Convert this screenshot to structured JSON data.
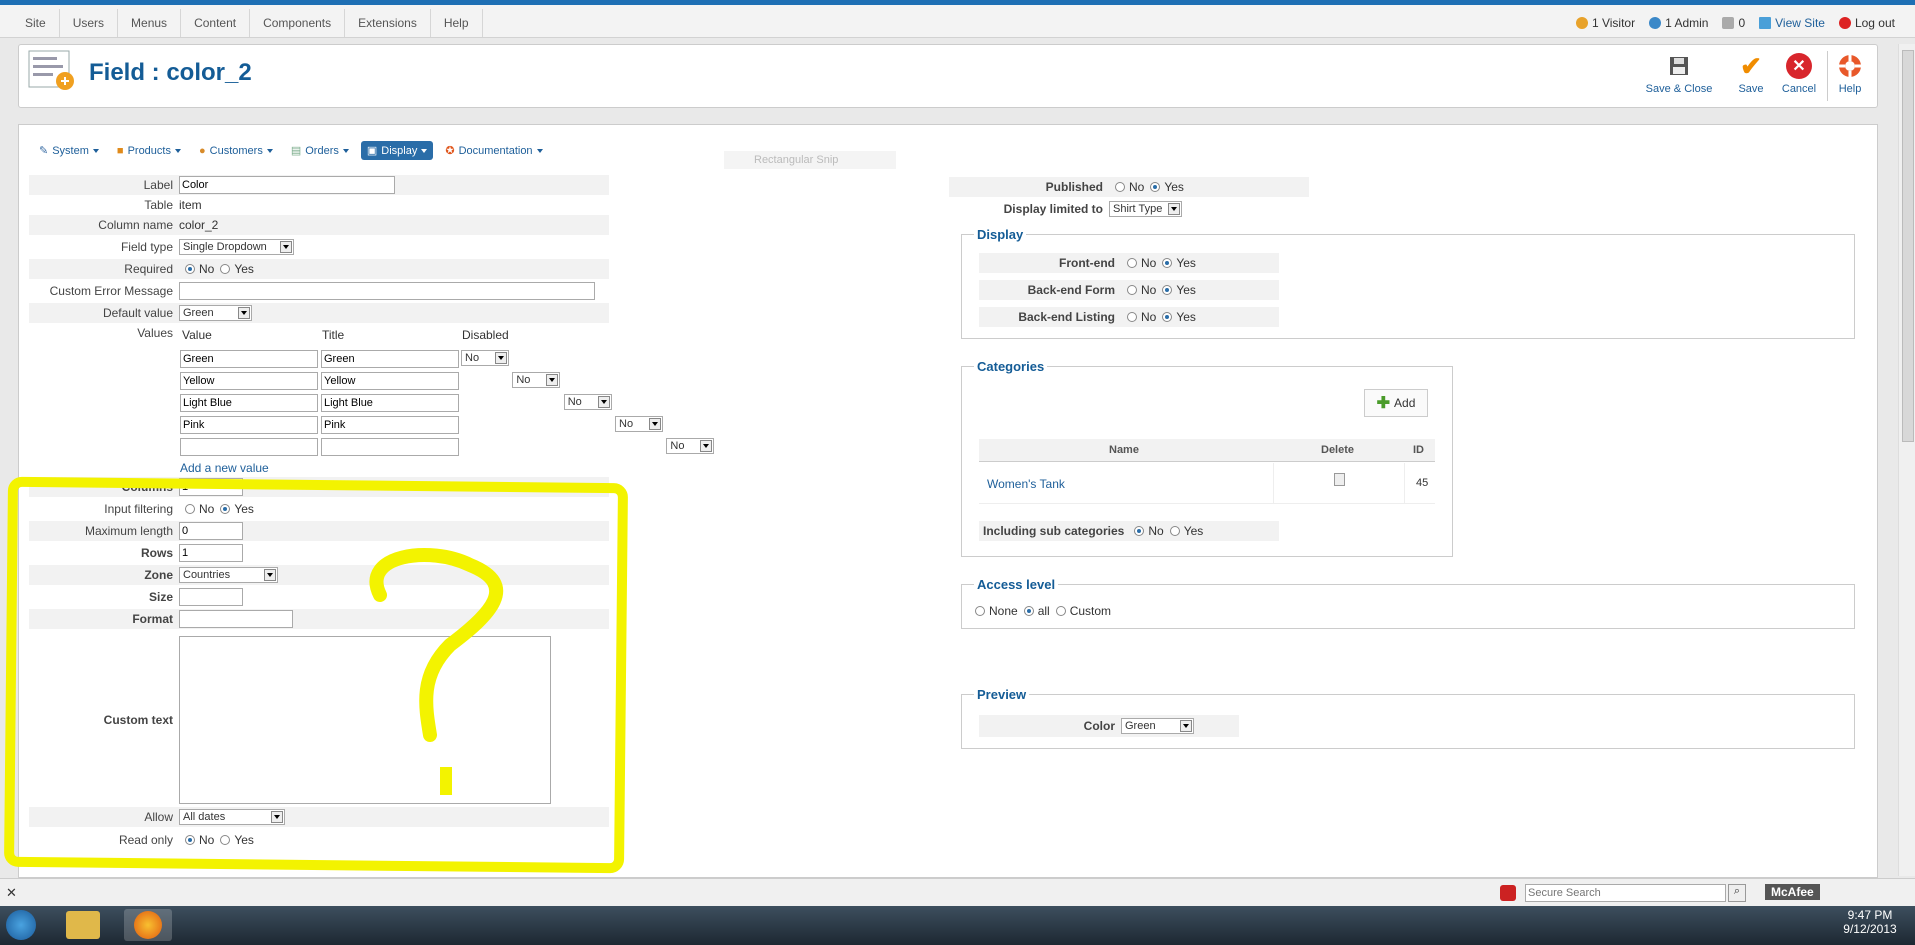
{
  "topbar": {
    "menu": [
      "Site",
      "Users",
      "Menus",
      "Content",
      "Components",
      "Extensions",
      "Help"
    ],
    "visitors": "1 Visitor",
    "admins": "1 Admin",
    "messages": "0",
    "view_site": "View Site",
    "logout": "Log out"
  },
  "header": {
    "title": "Field : color_2",
    "save_close": "Save & Close",
    "save": "Save",
    "cancel": "Cancel",
    "help": "Help"
  },
  "subnav": [
    "System",
    "Products",
    "Customers",
    "Orders",
    "Display",
    "Documentation"
  ],
  "ghost_snip": "Rectangular Snip",
  "form": {
    "label": {
      "label": "Label",
      "value": "Color"
    },
    "table": {
      "label": "Table",
      "value": "item"
    },
    "column_name": {
      "label": "Column name",
      "value": "color_2"
    },
    "field_type": {
      "label": "Field type",
      "value": "Single Dropdown"
    },
    "required": {
      "label": "Required",
      "no": "No",
      "yes": "Yes",
      "selected": "No"
    },
    "custom_error": {
      "label": "Custom Error Message",
      "value": ""
    },
    "default_value": {
      "label": "Default value",
      "value": "Green"
    },
    "values": {
      "label": "Values",
      "headers": [
        "Value",
        "Title",
        "Disabled"
      ],
      "rows": [
        {
          "value": "Green",
          "title": "Green",
          "disabled": "No"
        },
        {
          "value": "Yellow",
          "title": "Yellow",
          "disabled": "No"
        },
        {
          "value": "Light Blue",
          "title": "Light Blue",
          "disabled": "No"
        },
        {
          "value": "Pink",
          "title": "Pink",
          "disabled": "No"
        },
        {
          "value": "",
          "title": "",
          "disabled": "No"
        }
      ],
      "add_new": "Add a new value"
    },
    "columns": {
      "label": "Columns",
      "value": "1"
    },
    "input_filtering": {
      "label": "Input filtering",
      "no": "No",
      "yes": "Yes",
      "selected": "Yes"
    },
    "max_length": {
      "label": "Maximum length",
      "value": "0"
    },
    "rows": {
      "label": "Rows",
      "value": "1"
    },
    "zone": {
      "label": "Zone",
      "value": "Countries"
    },
    "size": {
      "label": "Size",
      "value": ""
    },
    "format": {
      "label": "Format",
      "value": ""
    },
    "custom_text": {
      "label": "Custom text",
      "value": ""
    },
    "allow": {
      "label": "Allow",
      "value": "All dates"
    },
    "read_only": {
      "label": "Read only",
      "no": "No",
      "yes": "Yes",
      "selected": "No"
    }
  },
  "right": {
    "published": {
      "label": "Published",
      "no": "No",
      "yes": "Yes",
      "selected": "Yes"
    },
    "display_limited": {
      "label": "Display limited to",
      "value": "Shirt Type"
    },
    "display": {
      "legend": "Display",
      "rows": [
        {
          "label": "Front-end",
          "no": "No",
          "yes": "Yes",
          "selected": "Yes"
        },
        {
          "label": "Back-end Form",
          "no": "No",
          "yes": "Yes",
          "selected": "Yes"
        },
        {
          "label": "Back-end Listing",
          "no": "No",
          "yes": "Yes",
          "selected": "Yes"
        }
      ]
    },
    "categories": {
      "legend": "Categories",
      "add": "Add",
      "headers": [
        "Name",
        "Delete",
        "ID"
      ],
      "rows": [
        {
          "name": "Women's Tank",
          "id": "45"
        }
      ],
      "including_sub": {
        "label": "Including sub categories",
        "no": "No",
        "yes": "Yes",
        "selected": "No"
      }
    },
    "access": {
      "legend": "Access level",
      "none": "None",
      "all": "all",
      "custom": "Custom",
      "selected": "all"
    },
    "preview": {
      "legend": "Preview",
      "label": "Color",
      "value": "Green"
    }
  },
  "browser": {
    "search_placeholder": "Secure Search",
    "mcafee": "McAfee"
  },
  "taskbar": {
    "time": "9:47 PM",
    "date": "9/12/2013"
  },
  "colors": {
    "accent": "#1e6fb4",
    "highlight": "#f3f300",
    "title": "#145c96"
  }
}
